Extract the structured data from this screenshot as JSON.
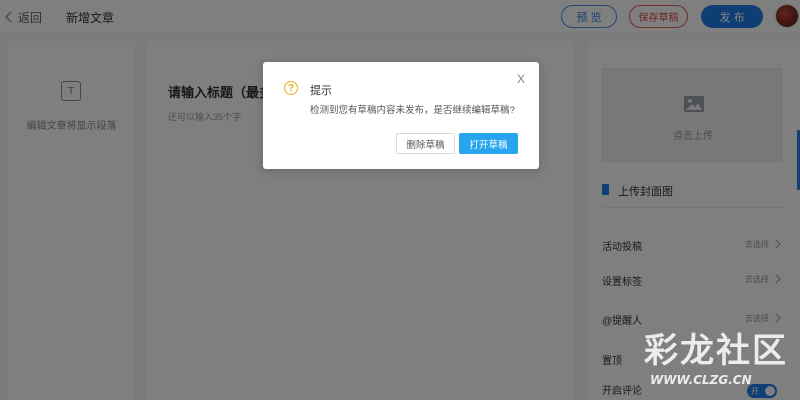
{
  "header": {
    "back_label": "返回",
    "title": "新增文章",
    "preview_label": "预 览",
    "save_draft_label": "保存草稿",
    "publish_label": "发 布"
  },
  "left_panel": {
    "icon": "text-paragraph-icon",
    "hint": "编辑文章将显示段落"
  },
  "editor": {
    "title_placeholder": "请输入标题（最多",
    "counter": "还可以输入35个字"
  },
  "right_panel": {
    "upload_label": "点击上传",
    "cover_title": "上传封面图",
    "settings": [
      {
        "label": "活动投稿",
        "value": "去选择"
      },
      {
        "label": "设置标签",
        "value": "去选择"
      },
      {
        "label": "@提醒人",
        "value": "去选择"
      },
      {
        "label": "置顶",
        "value": ""
      },
      {
        "label": "开启评论",
        "value": ""
      }
    ],
    "comment_toggle": {
      "on": true,
      "text": "开"
    }
  },
  "dialog": {
    "title": "提示",
    "message": "检测到您有草稿内容未发布，是否继续编辑草稿?",
    "delete_label": "删除草稿",
    "open_label": "打开草稿",
    "close_symbol": "X",
    "icon": "question-circle-icon"
  },
  "watermark": {
    "text": "彩龙社区",
    "url": "WWW.CLZG.CN"
  },
  "colors": {
    "primary": "#1e7ce8",
    "danger": "#e04848",
    "warning": "#f2a71b",
    "dialog_primary": "#29a4ee"
  }
}
